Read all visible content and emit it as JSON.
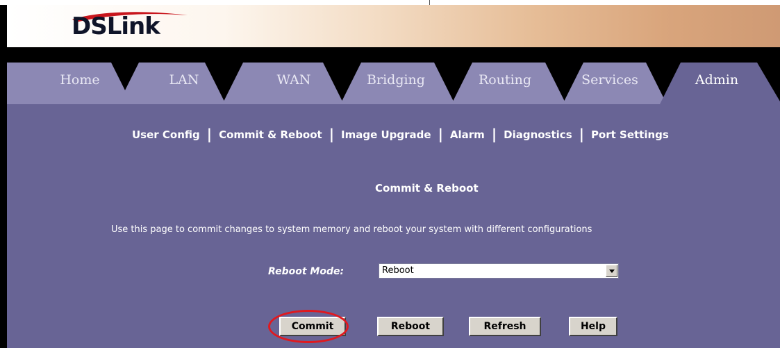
{
  "brand": {
    "logo_text": "DSLink"
  },
  "tabs": [
    {
      "label": "Home"
    },
    {
      "label": "LAN"
    },
    {
      "label": "WAN"
    },
    {
      "label": "Bridging"
    },
    {
      "label": "Routing"
    },
    {
      "label": "Services"
    },
    {
      "label": "Admin",
      "active": true
    }
  ],
  "submenu": [
    {
      "label": "User Config"
    },
    {
      "label": "Commit & Reboot"
    },
    {
      "label": "Image Upgrade"
    },
    {
      "label": "Alarm"
    },
    {
      "label": "Diagnostics"
    },
    {
      "label": "Port Settings"
    }
  ],
  "submenu_separator": "|",
  "page": {
    "title": "Commit & Reboot",
    "description": "Use this page to commit changes to system memory and reboot your system with different configurations"
  },
  "form": {
    "reboot_mode_label": "Reboot Mode:",
    "reboot_mode_value": "Reboot"
  },
  "buttons": {
    "commit": "Commit",
    "reboot": "Reboot",
    "refresh": "Refresh",
    "help": "Help"
  },
  "colors": {
    "panel": "#686495",
    "tab_fill": "#8c88b4",
    "highlight": "#e0191f"
  }
}
